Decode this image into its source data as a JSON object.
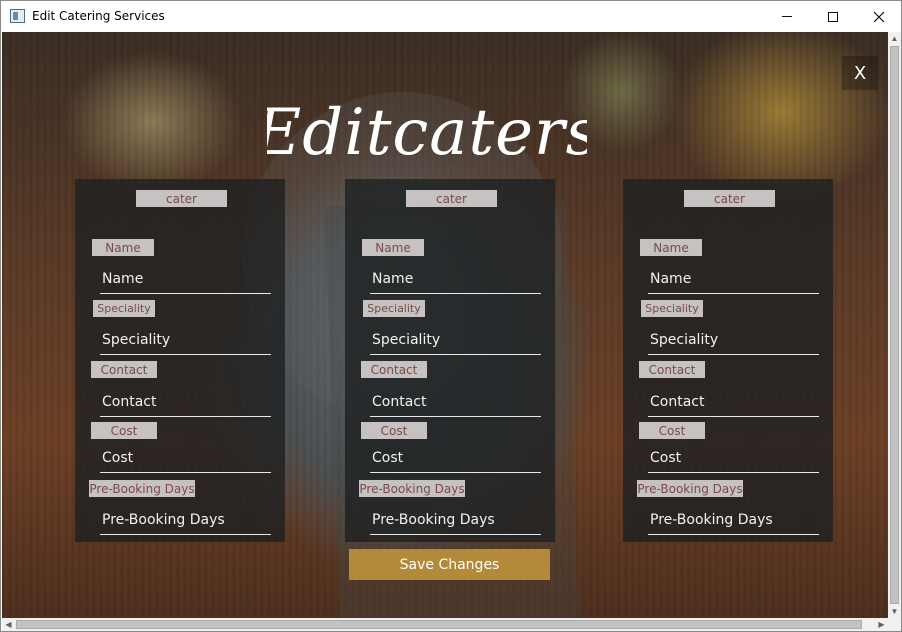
{
  "window": {
    "title": "Edit Catering Services",
    "icon": "app-window-icon"
  },
  "header": {
    "script_title": "Editcaters",
    "close_label": "X"
  },
  "cards": [
    {
      "title": "cater",
      "labels": {
        "name": "Name",
        "speciality": "Speciality",
        "contact": "Contact",
        "cost": "Cost",
        "prebooking": "Pre-Booking Days"
      },
      "placeholders": {
        "name": "Name",
        "speciality": "Speciality",
        "contact": "Contact",
        "cost": "Cost",
        "prebooking": "Pre-Booking Days"
      }
    },
    {
      "title": "cater",
      "labels": {
        "name": "Name",
        "speciality": "Speciality",
        "contact": "Contact",
        "cost": "Cost",
        "prebooking": "Pre-Booking Days"
      },
      "placeholders": {
        "name": "Name",
        "speciality": "Speciality",
        "contact": "Contact",
        "cost": "Cost",
        "prebooking": "Pre-Booking Days"
      }
    },
    {
      "title": "cater",
      "labels": {
        "name": "Name",
        "speciality": "Speciality",
        "contact": "Contact",
        "cost": "Cost",
        "prebooking": "Pre-Booking Days"
      },
      "placeholders": {
        "name": "Name",
        "speciality": "Speciality",
        "contact": "Contact",
        "cost": "Cost",
        "prebooking": "Pre-Booking Days"
      }
    }
  ],
  "actions": {
    "save_label": "Save Changes"
  },
  "colors": {
    "accent": "#b3893a",
    "tag_bg": "#c6c2c2",
    "tag_text": "#7a4a4a",
    "card_bg": "rgba(30,32,34,0.80)"
  }
}
